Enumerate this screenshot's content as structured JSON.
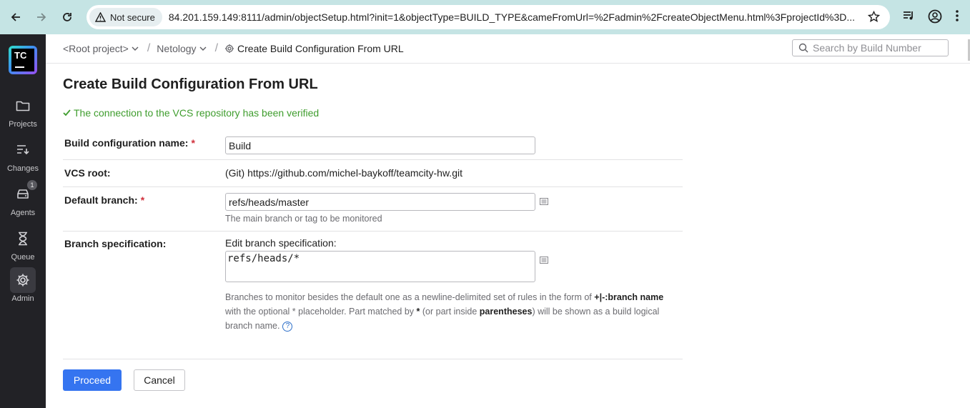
{
  "browser": {
    "security_label": "Not secure",
    "url": "84.201.159.149:8111/admin/objectSetup.html?init=1&objectType=BUILD_TYPE&cameFromUrl=%2Fadmin%2FcreateObjectMenu.html%3FprojectId%3D..."
  },
  "sidebar": {
    "logo_text": "TC",
    "items": [
      {
        "label": "Projects",
        "icon": "folder-icon"
      },
      {
        "label": "Changes",
        "icon": "changes-icon"
      },
      {
        "label": "Agents",
        "icon": "agents-icon",
        "badge": "1"
      },
      {
        "label": "Queue",
        "icon": "hourglass-icon"
      },
      {
        "label": "Admin",
        "icon": "gear-icon",
        "active": true
      }
    ]
  },
  "breadcrumb": {
    "root": "<Root project>",
    "project": "Netology",
    "current": "Create Build Configuration From URL"
  },
  "search": {
    "placeholder": "Search by Build Number"
  },
  "page": {
    "title": "Create Build Configuration From URL",
    "verified_message": "The connection to the VCS repository has been verified"
  },
  "form": {
    "name_label": "Build configuration name:",
    "name_value": "Build",
    "vcs_label": "VCS root:",
    "vcs_value": "(Git) https://github.com/michel-baykoff/teamcity-hw.git",
    "branch_label": "Default branch:",
    "branch_value": "refs/heads/master",
    "branch_hint": "The main branch or tag to be monitored",
    "spec_label": "Branch specification:",
    "spec_edit_label": "Edit branch specification:",
    "spec_value": "refs/heads/*",
    "spec_desc_1": "Branches to monitor besides the default one as a newline-delimited set of rules in the form of ",
    "spec_desc_bold_1": "+|-:branch name",
    "spec_desc_2": " with the optional * placeholder. Part matched by ",
    "spec_desc_bold_2": "*",
    "spec_desc_3": " (or part inside ",
    "spec_desc_bold_3": "parentheses",
    "spec_desc_4": ") will be shown as a build logical branch name.",
    "required_mark": "*",
    "help_glyph": "?"
  },
  "actions": {
    "proceed": "Proceed",
    "cancel": "Cancel"
  },
  "colors": {
    "chrome": "#c5e4e4",
    "sidebar": "#222226",
    "primary": "#3574f0",
    "success": "#3f9d2e",
    "required": "#d0303c"
  }
}
